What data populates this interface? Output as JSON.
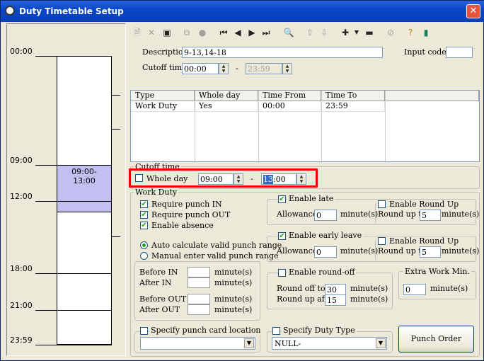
{
  "window": {
    "title": "Duty Timetable Setup",
    "close_label": "✕"
  },
  "timeline": {
    "labels": [
      "00:00",
      "09:00",
      "12:00",
      "18:00",
      "21:00",
      "23:59"
    ],
    "block_label_1": "09:00-",
    "block_label_2": "13:00"
  },
  "toolbar": {
    "icons": [
      "new-icon",
      "delete-icon",
      "save-icon",
      "copy-icon",
      "record-icon",
      "first-icon",
      "prev-icon",
      "next-icon",
      "last-icon",
      "find-icon",
      "up-icon",
      "down-icon",
      "add-icon",
      "dropdown-icon",
      "remove-icon",
      "disabled-icon",
      "help-icon",
      "exit-icon"
    ]
  },
  "header": {
    "description_label": "Description",
    "description_value": "9-13,14-18",
    "input_code_label": "Input code :",
    "input_code_value": "",
    "cutoff_label": "Cutoff time",
    "cutoff_from": "00:00",
    "cutoff_dash": "-",
    "cutoff_to": "23:59"
  },
  "grid": {
    "columns": [
      "Type",
      "Whole day",
      "Time From",
      "Time To"
    ],
    "rows": [
      [
        "Work Duty",
        "Yes",
        "00:00",
        "23:59"
      ]
    ]
  },
  "cutoff_group": {
    "title": "Cutoff time",
    "whole_day_label": "Whole day",
    "whole_day_checked": false,
    "from": "09:00",
    "dash": "-",
    "to_sel": "13",
    "to_rest": ":00"
  },
  "work_duty": {
    "title": "Work Duty",
    "require_in": "Require punch IN",
    "require_out": "Require punch OUT",
    "enable_absence": "Enable absence",
    "auto_calc": "Auto calculate valid punch range",
    "manual_enter": "Manual enter valid punch range",
    "before_in": "Before IN",
    "after_in": "After IN",
    "before_out": "Before OUT",
    "after_out": "After OUT",
    "minutes": "minute(s)"
  },
  "late": {
    "enable_late": "Enable late",
    "allowance_label": "Allowance",
    "allowance_value": "0",
    "minutes": "minute(s)",
    "round_up_enable": "Enable Round Up",
    "round_up_to": "Round up to",
    "round_up_value": "5"
  },
  "early": {
    "enable_early": "Enable early leave",
    "allowance_label": "Allowance",
    "allowance_value": "0",
    "minutes": "minute(s)",
    "round_up_enable": "Enable Round Up",
    "round_up_to": "Round up to",
    "round_up_value": "5"
  },
  "roundoff": {
    "enable": "Enable round-off",
    "round_off_to": "Round off to",
    "round_off_value": "30",
    "round_up_after": "Round up after",
    "round_up_after_value": "15",
    "minutes": "minute(s)"
  },
  "extra": {
    "title": "Extra Work Min.",
    "value": "0",
    "minutes": "minute(s)"
  },
  "punch_location": {
    "label": "Specify punch card location",
    "value": ""
  },
  "duty_type": {
    "label": "Specify Duty Type",
    "value": "NULL-"
  },
  "punch_order_button": "Punch Order"
}
